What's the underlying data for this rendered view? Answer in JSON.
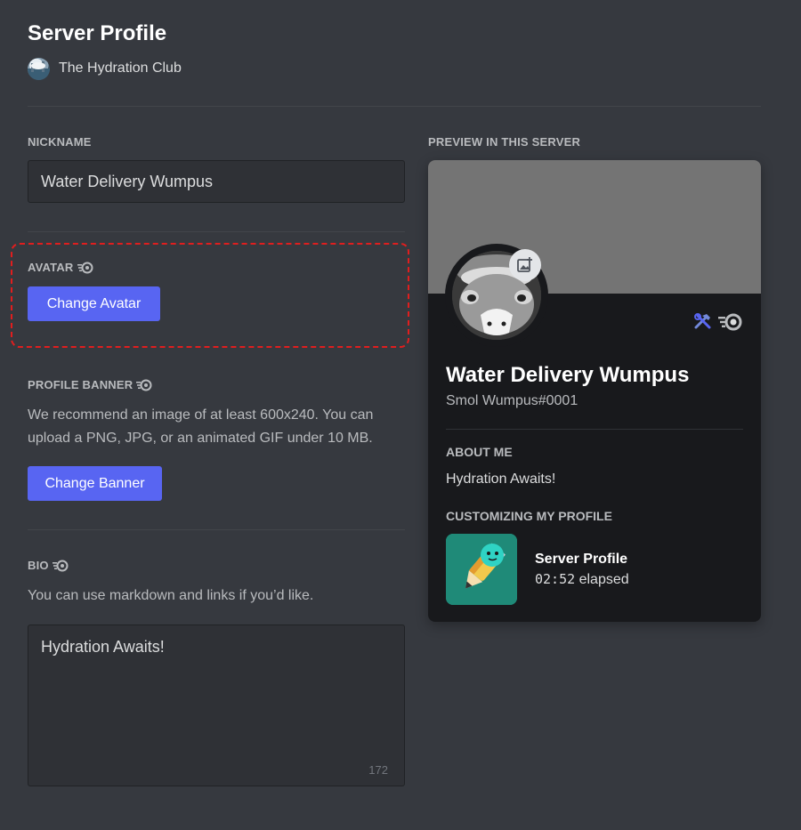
{
  "header": {
    "title": "Server Profile",
    "server_name": "The Hydration Club"
  },
  "nickname": {
    "label": "NICKNAME",
    "value": "Water Delivery Wumpus"
  },
  "avatar": {
    "label": "AVATAR",
    "button_label": "Change Avatar"
  },
  "banner": {
    "label": "PROFILE BANNER",
    "help_line1": "We recommend an image of at least 600x240. You can",
    "help_line2": "upload a PNG, JPG, or an animated GIF under 10 MB.",
    "button_label": "Change Banner"
  },
  "bio": {
    "label": "BIO",
    "help": "You can use markdown and links if you’d like.",
    "value": "Hydration Awaits!",
    "char_count": "172"
  },
  "preview": {
    "label": "PREVIEW IN THIS SERVER",
    "display_name": "Water Delivery Wumpus",
    "tag": "Smol Wumpus#0001",
    "about_heading": "ABOUT ME",
    "about_text": "Hydration Awaits!",
    "activity_heading": "CUSTOMIZING MY PROFILE",
    "activity_name": "Server Profile",
    "activity_time": "02:52",
    "activity_suffix": " elapsed"
  },
  "colors": {
    "accent": "#5865f2",
    "background": "#36393f",
    "card": "#18191c",
    "banner": "#747474",
    "highlight_dashed": "#e01e1e"
  },
  "icons": [
    "server-icon",
    "nitro-icon",
    "add-image-icon",
    "hammer-wrench-badge-icon",
    "nitro-badge-icon"
  ]
}
